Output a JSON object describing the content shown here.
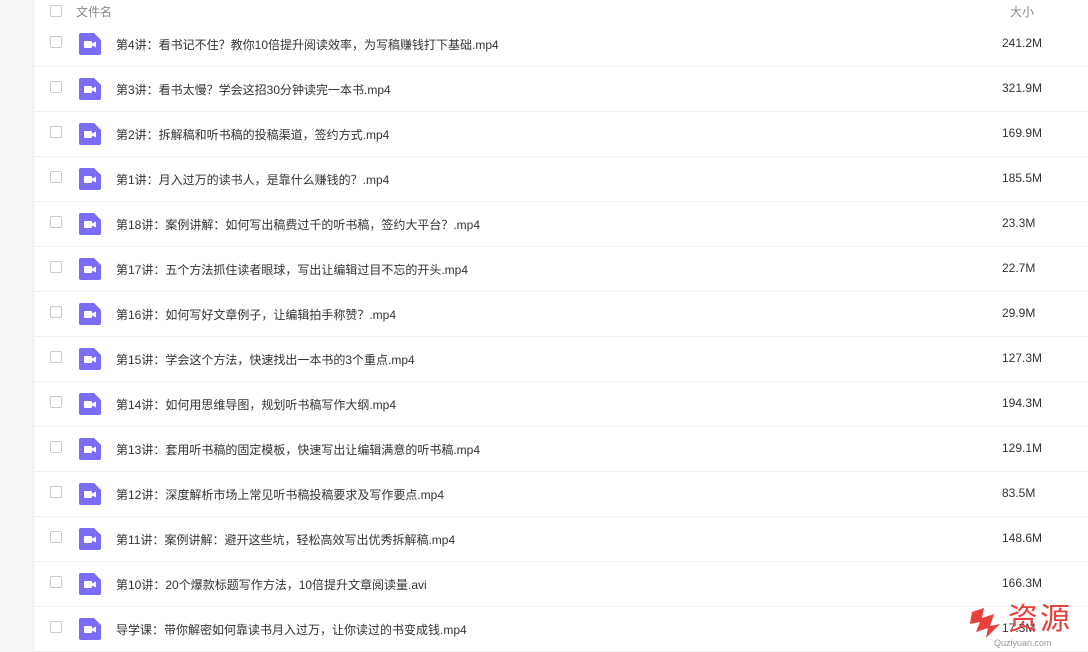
{
  "header": {
    "name_label": "文件名",
    "size_label": "大小"
  },
  "files": [
    {
      "name": "第4讲：看书记不住？教你10倍提升阅读效率，为写稿赚钱打下基础.mp4",
      "size": "241.2M",
      "icon": "video-file-icon"
    },
    {
      "name": "第3讲：看书太慢？学会这招30分钟读完一本书.mp4",
      "size": "321.9M",
      "icon": "video-file-icon"
    },
    {
      "name": "第2讲：拆解稿和听书稿的投稿渠道，签约方式.mp4",
      "size": "169.9M",
      "icon": "video-file-icon"
    },
    {
      "name": "第1讲：月入过万的读书人，是靠什么赚钱的？.mp4",
      "size": "185.5M",
      "icon": "video-file-icon"
    },
    {
      "name": "第18讲：案例讲解：如何写出稿费过千的听书稿，签约大平台？.mp4",
      "size": "23.3M",
      "icon": "video-file-icon"
    },
    {
      "name": "第17讲：五个方法抓住读者眼球，写出让编辑过目不忘的开头.mp4",
      "size": "22.7M",
      "icon": "video-file-icon"
    },
    {
      "name": "第16讲：如何写好文章例子，让编辑拍手称赞？.mp4",
      "size": "29.9M",
      "icon": "video-file-icon"
    },
    {
      "name": "第15讲：学会这个方法，快速找出一本书的3个重点.mp4",
      "size": "127.3M",
      "icon": "video-file-icon"
    },
    {
      "name": "第14讲：如何用思维导图，规划听书稿写作大纲.mp4",
      "size": "194.3M",
      "icon": "video-file-icon"
    },
    {
      "name": "第13讲：套用听书稿的固定模板，快速写出让编辑满意的听书稿.mp4",
      "size": "129.1M",
      "icon": "video-file-icon"
    },
    {
      "name": "第12讲：深度解析市场上常见听书稿投稿要求及写作要点.mp4",
      "size": "83.5M",
      "icon": "video-file-icon"
    },
    {
      "name": "第11讲：案例讲解：避开这些坑，轻松高效写出优秀拆解稿.mp4",
      "size": "148.6M",
      "icon": "video-file-icon"
    },
    {
      "name": "第10讲：20个爆款标题写作方法，10倍提升文章阅读量.avi",
      "size": "166.3M",
      "icon": "video-file-icon"
    },
    {
      "name": "导学课：带你解密如何靠读书月入过万，让你读过的书变成钱.mp4",
      "size": "17.3M",
      "icon": "video-file-icon"
    }
  ],
  "watermark": {
    "text": "资源",
    "domain": "Quziyuan.com"
  },
  "colors": {
    "icon_purple": "#7b6cf6",
    "watermark_red": "#e8413b"
  }
}
